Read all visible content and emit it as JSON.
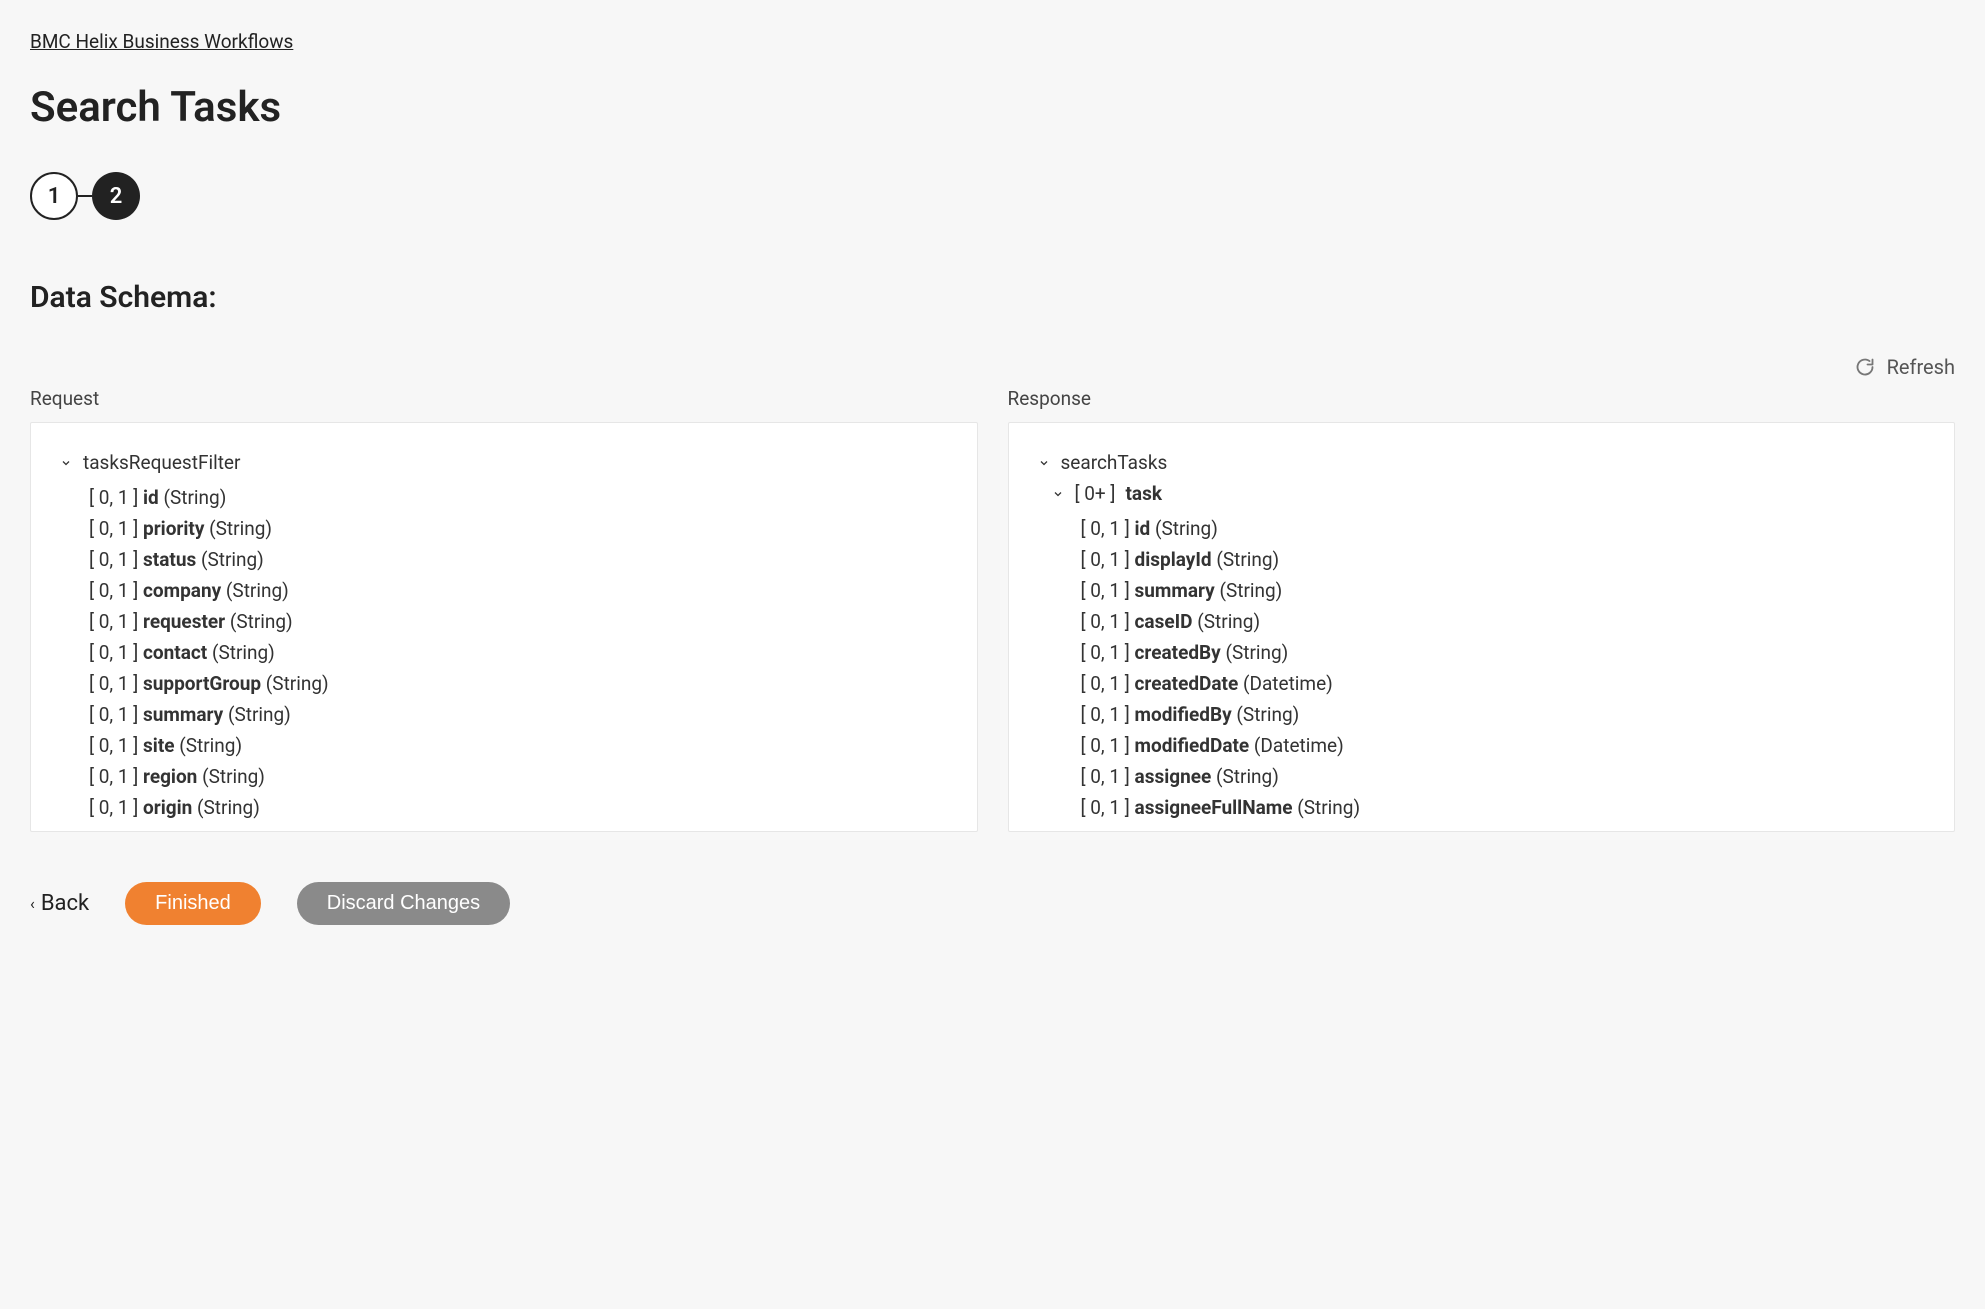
{
  "breadcrumb": "BMC Helix Business Workflows",
  "page_title": "Search Tasks",
  "stepper": {
    "step1": "1",
    "step2": "2"
  },
  "section_title": "Data Schema:",
  "refresh_label": "Refresh",
  "request": {
    "label": "Request",
    "root": "tasksRequestFilter",
    "fields": [
      {
        "card": "[ 0, 1 ]",
        "name": "id",
        "type": "(String)"
      },
      {
        "card": "[ 0, 1 ]",
        "name": "priority",
        "type": "(String)"
      },
      {
        "card": "[ 0, 1 ]",
        "name": "status",
        "type": "(String)"
      },
      {
        "card": "[ 0, 1 ]",
        "name": "company",
        "type": "(String)"
      },
      {
        "card": "[ 0, 1 ]",
        "name": "requester",
        "type": "(String)"
      },
      {
        "card": "[ 0, 1 ]",
        "name": "contact",
        "type": "(String)"
      },
      {
        "card": "[ 0, 1 ]",
        "name": "supportGroup",
        "type": "(String)"
      },
      {
        "card": "[ 0, 1 ]",
        "name": "summary",
        "type": "(String)"
      },
      {
        "card": "[ 0, 1 ]",
        "name": "site",
        "type": "(String)"
      },
      {
        "card": "[ 0, 1 ]",
        "name": "region",
        "type": "(String)"
      },
      {
        "card": "[ 0, 1 ]",
        "name": "origin",
        "type": "(String)"
      }
    ]
  },
  "response": {
    "label": "Response",
    "root": "searchTasks",
    "child_card": "[ 0+ ]",
    "child_name": "task",
    "fields": [
      {
        "card": "[ 0, 1 ]",
        "name": "id",
        "type": "(String)"
      },
      {
        "card": "[ 0, 1 ]",
        "name": "displayId",
        "type": "(String)"
      },
      {
        "card": "[ 0, 1 ]",
        "name": "summary",
        "type": "(String)"
      },
      {
        "card": "[ 0, 1 ]",
        "name": "caseID",
        "type": "(String)"
      },
      {
        "card": "[ 0, 1 ]",
        "name": "createdBy",
        "type": "(String)"
      },
      {
        "card": "[ 0, 1 ]",
        "name": "createdDate",
        "type": "(Datetime)"
      },
      {
        "card": "[ 0, 1 ]",
        "name": "modifiedBy",
        "type": "(String)"
      },
      {
        "card": "[ 0, 1 ]",
        "name": "modifiedDate",
        "type": "(Datetime)"
      },
      {
        "card": "[ 0, 1 ]",
        "name": "assignee",
        "type": "(String)"
      },
      {
        "card": "[ 0, 1 ]",
        "name": "assigneeFullName",
        "type": "(String)"
      }
    ]
  },
  "footer": {
    "back": "Back",
    "finished": "Finished",
    "discard": "Discard Changes"
  }
}
